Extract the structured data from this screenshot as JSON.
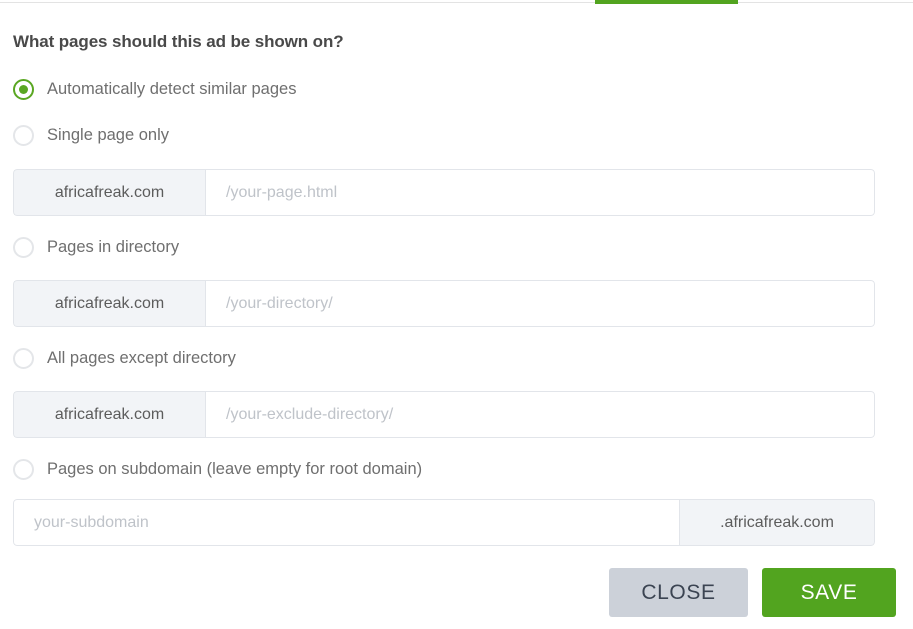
{
  "top_strip": {
    "green_tab_color": "#52a41f",
    "divider_color": "#e3e3e3"
  },
  "panel": {
    "heading": "What pages should this ad be shown on?"
  },
  "options": [
    {
      "id": "auto-detect",
      "label": "Automatically detect similar pages",
      "selected": true
    },
    {
      "id": "single-page",
      "label": "Single page only",
      "selected": false
    },
    {
      "id": "pages-in-directory",
      "label": "Pages in directory",
      "selected": false
    },
    {
      "id": "all-pages-except-directory",
      "label": "All pages except directory",
      "selected": false
    },
    {
      "id": "pages-on-subdomain",
      "label": "Pages on subdomain (leave empty for root domain)",
      "selected": false
    }
  ],
  "fields": {
    "single_page": {
      "prefix": "africafreak.com",
      "placeholder": "/your-page.html",
      "value": ""
    },
    "directory": {
      "prefix": "africafreak.com",
      "placeholder": "/your-directory/",
      "value": ""
    },
    "exclude_directory": {
      "prefix": "africafreak.com",
      "placeholder": "/your-exclude-directory/",
      "value": ""
    },
    "subdomain": {
      "placeholder": "your-subdomain",
      "value": "",
      "suffix": ".africafreak.com"
    }
  },
  "buttons": {
    "close_label": "CLOSE",
    "save_label": "SAVE",
    "close_color": "#ccd1d9",
    "save_color": "#52a41f"
  }
}
